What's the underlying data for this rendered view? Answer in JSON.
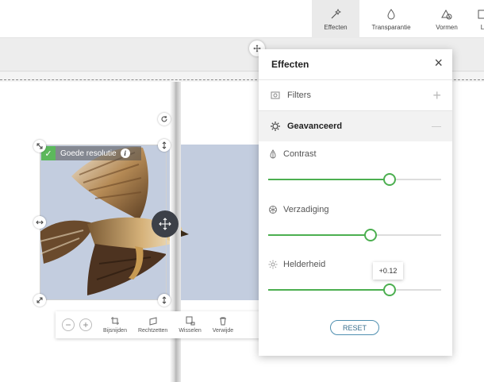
{
  "toolbar": {
    "tabs": [
      {
        "label": "Effecten",
        "icon": "wand-icon",
        "active": true
      },
      {
        "label": "Transparantie",
        "icon": "droplet-icon",
        "active": false
      },
      {
        "label": "Vormen",
        "icon": "shapes-icon",
        "active": false
      },
      {
        "label": "L",
        "icon": "layout-icon",
        "active": false
      }
    ]
  },
  "photo": {
    "quality_badge": "Goede resolutie",
    "info_glyph": "i"
  },
  "image_toolbar": {
    "zoom_out": "−",
    "zoom_in": "+",
    "tools": [
      "Bijsnijden",
      "Rechtzetten",
      "Wisselen",
      "Verwijde"
    ]
  },
  "panel": {
    "title": "Effecten",
    "close": "×",
    "sections": {
      "filters": "Filters",
      "advanced": "Geavanceerd"
    },
    "sliders": [
      {
        "label": "Contrast",
        "icon": "contrast-icon",
        "value": 0.7
      },
      {
        "label": "Verzadiging",
        "icon": "saturation-icon",
        "value": 0.59
      },
      {
        "label": "Helderheid",
        "icon": "brightness-icon",
        "value": 0.7
      }
    ],
    "tooltip": "+0.12",
    "reset": "RESET"
  },
  "colors": {
    "accent_green": "#4caf50",
    "reset_blue": "#3b6f8e",
    "badge_green": "#5cb85c"
  }
}
